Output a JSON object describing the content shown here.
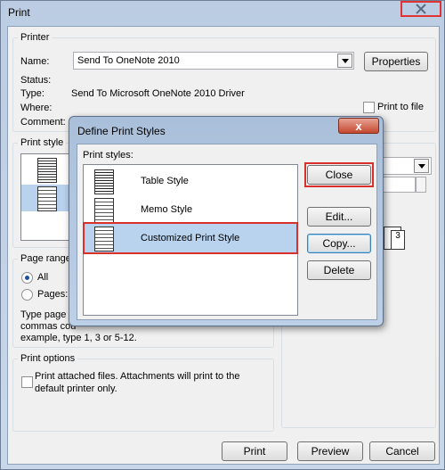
{
  "window": {
    "title": "Print"
  },
  "printer": {
    "group_label": "Printer",
    "name_label": "Name:",
    "name_value": "Send To OneNote 2010",
    "properties_button": "Properties",
    "status_label": "Status:",
    "type_label": "Type:",
    "type_value": "Send To Microsoft OneNote 2010 Driver",
    "where_label": "Where:",
    "comment_label": "Comment:",
    "print_to_file_label": "Print to file"
  },
  "print_style": {
    "group_label": "Print style"
  },
  "page_range": {
    "group_label": "Page range",
    "all_label": "All",
    "pages_label": "Pages:",
    "help_line1": "Type page n",
    "help_line2": "commas cou",
    "help_line3": "example, type 1, 3 or 5-12."
  },
  "print_options": {
    "group_label": "Print options",
    "attach_line1": "Print attached files.  Attachments will print to the",
    "attach_line2": "default printer only."
  },
  "copies": {
    "collate_page_number": "3"
  },
  "footer": {
    "print_button": "Print",
    "preview_button": "Preview",
    "cancel_button": "Cancel"
  },
  "dialog": {
    "title": "Define Print Styles",
    "close_glyph": "x",
    "styles_label": "Print styles:",
    "styles": [
      {
        "label": "Table Style",
        "icon": "table-style-icon"
      },
      {
        "label": "Memo Style",
        "icon": "memo-style-icon"
      },
      {
        "label": "Customized Print Style",
        "icon": "memo-style-icon",
        "selected": true
      }
    ],
    "close_button": "Close",
    "edit_button": "Edit...",
    "copy_button": "Copy...",
    "delete_button": "Delete"
  },
  "colors": {
    "highlight_red": "#d9302c",
    "selection_blue": "#b9d3ee",
    "window_frame": "#bccde3"
  }
}
